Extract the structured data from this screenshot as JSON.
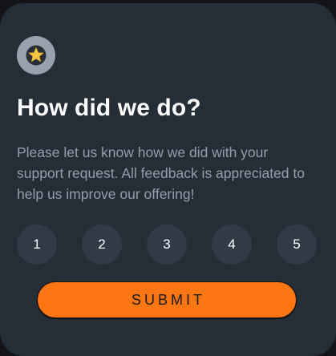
{
  "card": {
    "icon": "star-icon",
    "title": "How did we do?",
    "description": "Please let us know how we did with your support request. All feedback is appreciated to help us improve our offering!",
    "ratings": [
      "1",
      "2",
      "3",
      "4",
      "5"
    ],
    "submit_label": "SUBMIT"
  },
  "colors": {
    "card_background": "#252d37",
    "rating_background": "#313a47",
    "icon_circle": "#98a1ae",
    "accent": "#fc7614",
    "star": "#f5c542",
    "description_text": "#959eab"
  }
}
